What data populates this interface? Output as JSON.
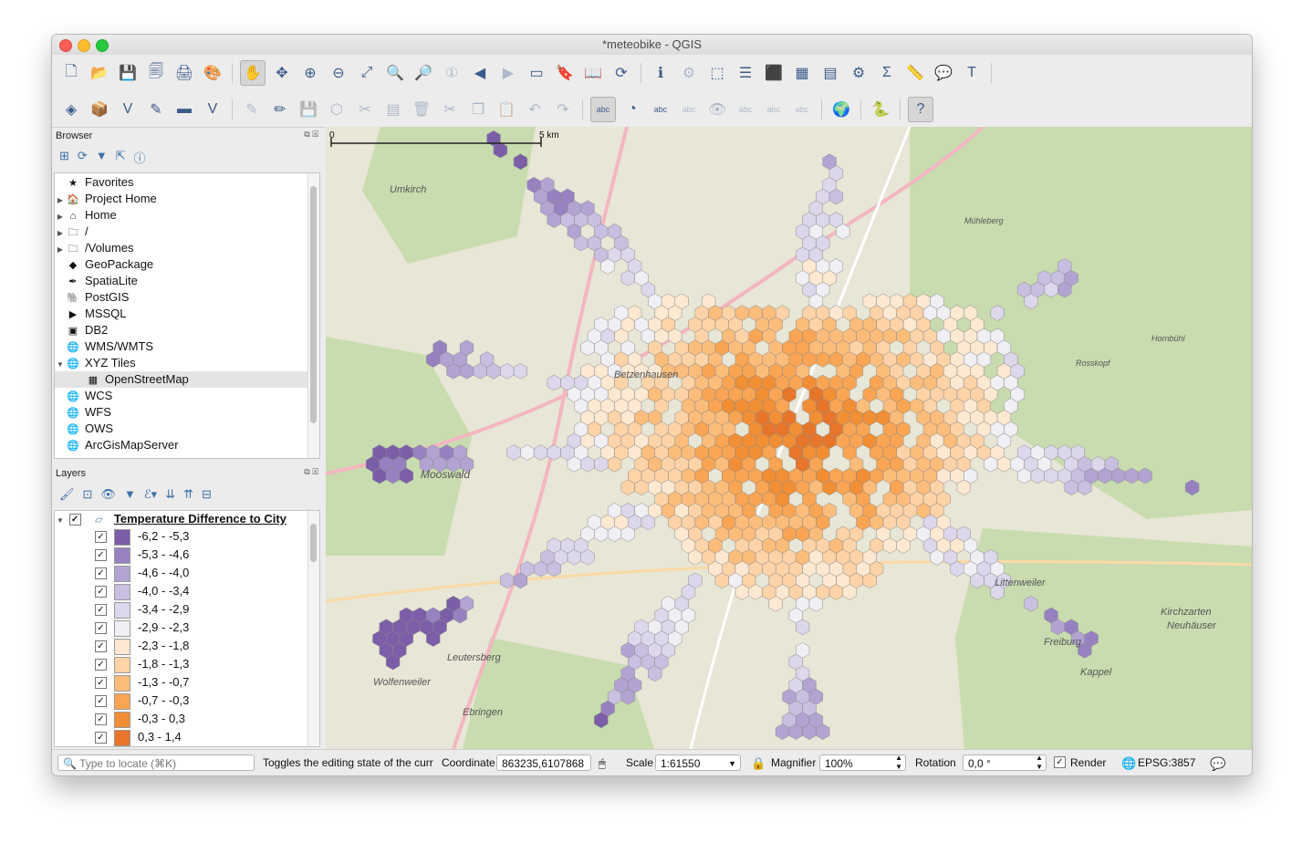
{
  "window": {
    "title": "*meteobike - QGIS"
  },
  "icons": {
    "toolbar1": [
      "new-project-icon",
      "open-project-icon",
      "save-project-icon",
      "save-as-icon",
      "print-layout-icon",
      "style-manager-icon",
      "pan-icon",
      "pan-to-selection-icon",
      "zoom-in-icon",
      "zoom-out-icon",
      "zoom-full-icon",
      "zoom-to-selection-icon",
      "zoom-to-layer-icon",
      "zoom-native-icon",
      "zoom-last-icon",
      "zoom-next-icon",
      "new-map-view-icon",
      "new-bookmark-icon",
      "show-bookmarks-icon",
      "refresh-icon",
      "identify-icon",
      "run-action-icon",
      "select-features-icon",
      "select-by-value-icon",
      "deselect-icon",
      "attribute-table-icon",
      "field-calculator-icon",
      "processing-toolbox-icon",
      "statistics-icon",
      "measure-icon",
      "map-tips-icon",
      "text-annotation-icon"
    ],
    "toolbar2": [
      "data-source-manager-icon",
      "new-geopackage-layer-icon",
      "new-shapefile-layer-icon",
      "new-spatialite-layer-icon",
      "new-temporary-layer-icon",
      "new-virtual-layer-icon",
      "current-edits-icon",
      "toggle-editing-icon",
      "save-edits-icon",
      "add-feature-icon",
      "vertex-tool-icon",
      "modify-attributes-icon",
      "delete-selected-icon",
      "cut-features-icon",
      "copy-features-icon",
      "paste-features-icon",
      "undo-icon",
      "redo-icon",
      "label-tool-icon",
      "diagram-tool-icon",
      "layer-labeling-icon",
      "pin-labels-icon",
      "show-hide-labels-icon",
      "move-label-icon",
      "rotate-label-icon",
      "change-label-icon",
      "plugin-globe-icon",
      "python-console-icon",
      "help-icon"
    ]
  },
  "browser": {
    "title": "Browser",
    "items": [
      {
        "label": "Favorites",
        "icon": "star-icon",
        "expand": ""
      },
      {
        "label": "Project Home",
        "icon": "project-home-icon",
        "expand": "▶"
      },
      {
        "label": "Home",
        "icon": "home-icon",
        "expand": "▶"
      },
      {
        "label": "/",
        "icon": "folder-icon",
        "expand": "▶"
      },
      {
        "label": "/Volumes",
        "icon": "folder-icon",
        "expand": "▶"
      },
      {
        "label": "GeoPackage",
        "icon": "geopackage-icon",
        "expand": ""
      },
      {
        "label": "SpatiaLite",
        "icon": "spatialite-icon",
        "expand": ""
      },
      {
        "label": "PostGIS",
        "icon": "postgis-icon",
        "expand": ""
      },
      {
        "label": "MSSQL",
        "icon": "mssql-icon",
        "expand": ""
      },
      {
        "label": "DB2",
        "icon": "db2-icon",
        "expand": ""
      },
      {
        "label": "WMS/WMTS",
        "icon": "globe-icon",
        "expand": ""
      },
      {
        "label": "XYZ Tiles",
        "icon": "globe-icon",
        "expand": "▼"
      },
      {
        "label": "OpenStreetMap",
        "icon": "tiles-icon",
        "expand": "",
        "child": true
      },
      {
        "label": "WCS",
        "icon": "globe-icon",
        "expand": ""
      },
      {
        "label": "WFS",
        "icon": "globe-icon",
        "expand": ""
      },
      {
        "label": "OWS",
        "icon": "globe-icon",
        "expand": ""
      },
      {
        "label": "ArcGisMapServer",
        "icon": "globe-icon",
        "expand": ""
      }
    ]
  },
  "layers": {
    "title": "Layers",
    "layer_name": "Temperature Difference to City",
    "classes": [
      {
        "label": "-6,2 - -5,3",
        "color": "#7b5ea7"
      },
      {
        "label": "-5,3 - -4,6",
        "color": "#9881c0"
      },
      {
        "label": "-4,6 - -4,0",
        "color": "#b3a3d2"
      },
      {
        "label": "-4,0 - -3,4",
        "color": "#c9bfe0"
      },
      {
        "label": "-3,4 - -2,9",
        "color": "#ddd7ec"
      },
      {
        "label": "-2,9 - -2,3",
        "color": "#f0eff4"
      },
      {
        "label": "-2,3 - -1,8",
        "color": "#fde8d1"
      },
      {
        "label": "-1,8 - -1,3",
        "color": "#fdd3a7"
      },
      {
        "label": "-1,3 - -0,7",
        "color": "#fcbd7b"
      },
      {
        "label": "-0,7 - -0,3",
        "color": "#f9a553"
      },
      {
        "label": "-0,3 - 0,3",
        "color": "#f28e34"
      },
      {
        "label": "0,3 - 1,4",
        "color": "#e8762a"
      }
    ]
  },
  "map": {
    "scalebar": {
      "start": "0",
      "end": "5 km"
    },
    "labels": [
      "Umkirch",
      "Mooswald",
      "Betzenhausen",
      "Littenweiler",
      "Kirchzarten",
      "Neuhäuser",
      "Kappel",
      "Leutersberg",
      "Wolfenweiler",
      "Ebringen",
      "Hornbühl",
      "Rosskopf",
      "Mühleberg",
      "Freiburg"
    ]
  },
  "status": {
    "locate_placeholder": "Type to locate (⌘K)",
    "message": "Toggles the editing state of the curr",
    "coordinate_label": "Coordinate",
    "coordinate_value": "863235,6107868",
    "scale_label": "Scale",
    "scale_value": "1:61550",
    "magnifier_label": "Magnifier",
    "magnifier_value": "100%",
    "rotation_label": "Rotation",
    "rotation_value": "0,0 °",
    "render_label": "Render",
    "crs": "EPSG:3857"
  }
}
